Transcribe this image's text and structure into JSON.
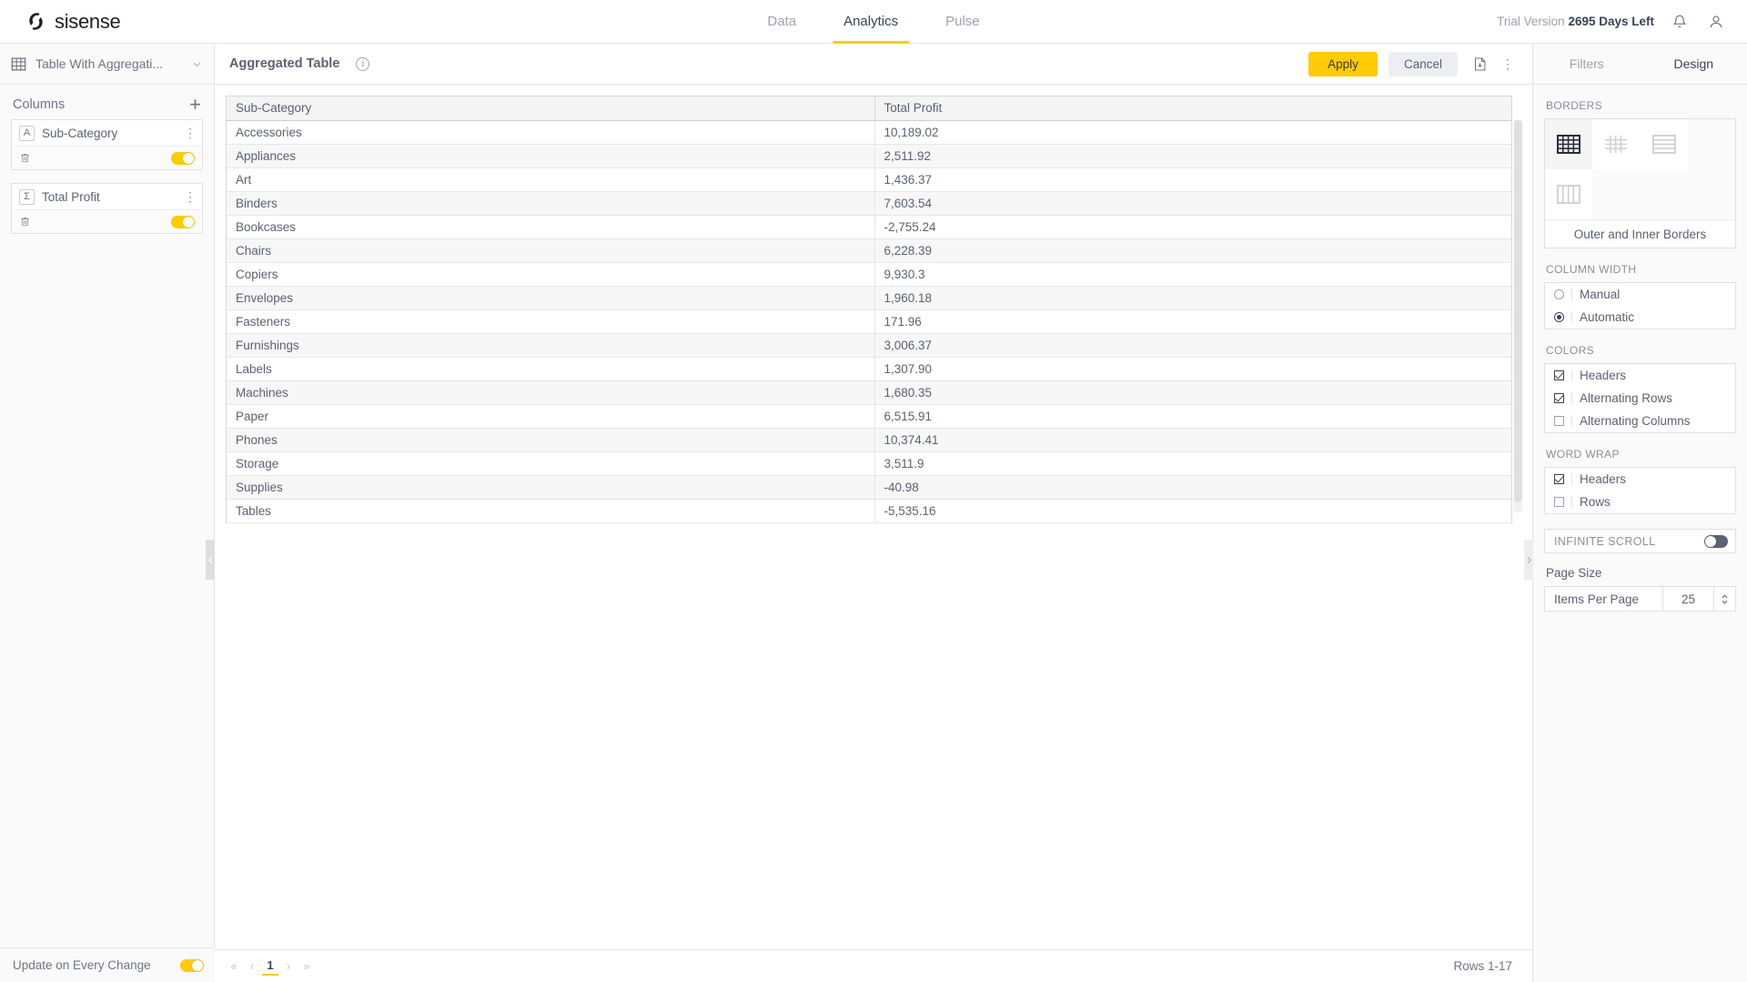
{
  "brand": {
    "name": "sisense",
    "logo_icon": "sisense-logo-icon"
  },
  "topnav": {
    "items": [
      {
        "label": "Data",
        "active": false
      },
      {
        "label": "Analytics",
        "active": true
      },
      {
        "label": "Pulse",
        "active": false
      }
    ],
    "trial_prefix": "Trial Version",
    "trial_days": "2695 Days Left",
    "bell_icon": "notification-bell-icon",
    "user_icon": "user-account-icon"
  },
  "left_panel": {
    "widget_type": {
      "label": "Table With Aggregati...",
      "icon": "table-grid-icon",
      "chevron": "chevron-down-icon"
    },
    "columns_section": {
      "title": "Columns",
      "add_label": "+"
    },
    "fields": [
      {
        "name": "Sub-Category",
        "type_badge": "A",
        "toggle_on": true,
        "trash_icon": "trash-icon",
        "menu_icon": "kebab-menu-icon"
      },
      {
        "name": "Total Profit",
        "type_badge": "Σ",
        "toggle_on": true,
        "trash_icon": "trash-icon",
        "menu_icon": "kebab-menu-icon"
      }
    ],
    "footer": {
      "label": "Update on Every Change",
      "toggle_on": true
    },
    "collapse_icon": "chevron-left-icon"
  },
  "widget": {
    "title": "Aggregated Table",
    "info_icon": "info-icon",
    "apply_label": "Apply",
    "cancel_label": "Cancel",
    "export_icon": "export-document-icon",
    "menu_icon": "kebab-menu-icon",
    "accent_color": "#ffcb05"
  },
  "table": {
    "columns": [
      "Sub-Category",
      "Total Profit"
    ],
    "rows": [
      [
        "Accessories",
        "10,189.02"
      ],
      [
        "Appliances",
        "2,511.92"
      ],
      [
        "Art",
        "1,436.37"
      ],
      [
        "Binders",
        "7,603.54"
      ],
      [
        "Bookcases",
        "-2,755.24"
      ],
      [
        "Chairs",
        "6,228.39"
      ],
      [
        "Copiers",
        "9,930.3"
      ],
      [
        "Envelopes",
        "1,960.18"
      ],
      [
        "Fasteners",
        "171.96"
      ],
      [
        "Furnishings",
        "3,006.37"
      ],
      [
        "Labels",
        "1,307.90"
      ],
      [
        "Machines",
        "1,680.35"
      ],
      [
        "Paper",
        "6,515.91"
      ],
      [
        "Phones",
        "10,374.41"
      ],
      [
        "Storage",
        "3,511.9"
      ],
      [
        "Supplies",
        "-40.98"
      ],
      [
        "Tables",
        "-5,535.16"
      ]
    ]
  },
  "pager": {
    "first_icon": "«",
    "prev_icon": "‹",
    "current_page": "1",
    "next_icon": "›",
    "last_icon": "»",
    "rows_label": "Rows 1-17"
  },
  "right_panel": {
    "tabs": [
      {
        "label": "Filters",
        "active": false
      },
      {
        "label": "Design",
        "active": true
      }
    ],
    "borders": {
      "title": "BORDERS",
      "options": [
        {
          "icon": "outer-and-inner-borders-icon",
          "selected": true
        },
        {
          "icon": "inner-borders-icon",
          "selected": false
        },
        {
          "icon": "horizontal-borders-icon",
          "selected": false
        },
        {
          "icon": "vertical-borders-icon",
          "selected": false
        }
      ],
      "caption": "Outer and Inner Borders"
    },
    "column_width": {
      "title": "COLUMN WIDTH",
      "options": [
        {
          "label": "Manual",
          "selected": false
        },
        {
          "label": "Automatic",
          "selected": true
        }
      ]
    },
    "colors": {
      "title": "COLORS",
      "options": [
        {
          "label": "Headers",
          "checked": true
        },
        {
          "label": "Alternating Rows",
          "checked": true
        },
        {
          "label": "Alternating Columns",
          "checked": false
        }
      ]
    },
    "word_wrap": {
      "title": "WORD WRAP",
      "options": [
        {
          "label": "Headers",
          "checked": true
        },
        {
          "label": "Rows",
          "checked": false
        }
      ]
    },
    "infinite_scroll": {
      "label": "INFINITE SCROLL",
      "toggle_on": false
    },
    "page_size": {
      "title": "Page Size",
      "label": "Items Per Page",
      "value": "25"
    },
    "collapse_icon": "chevron-right-icon"
  }
}
